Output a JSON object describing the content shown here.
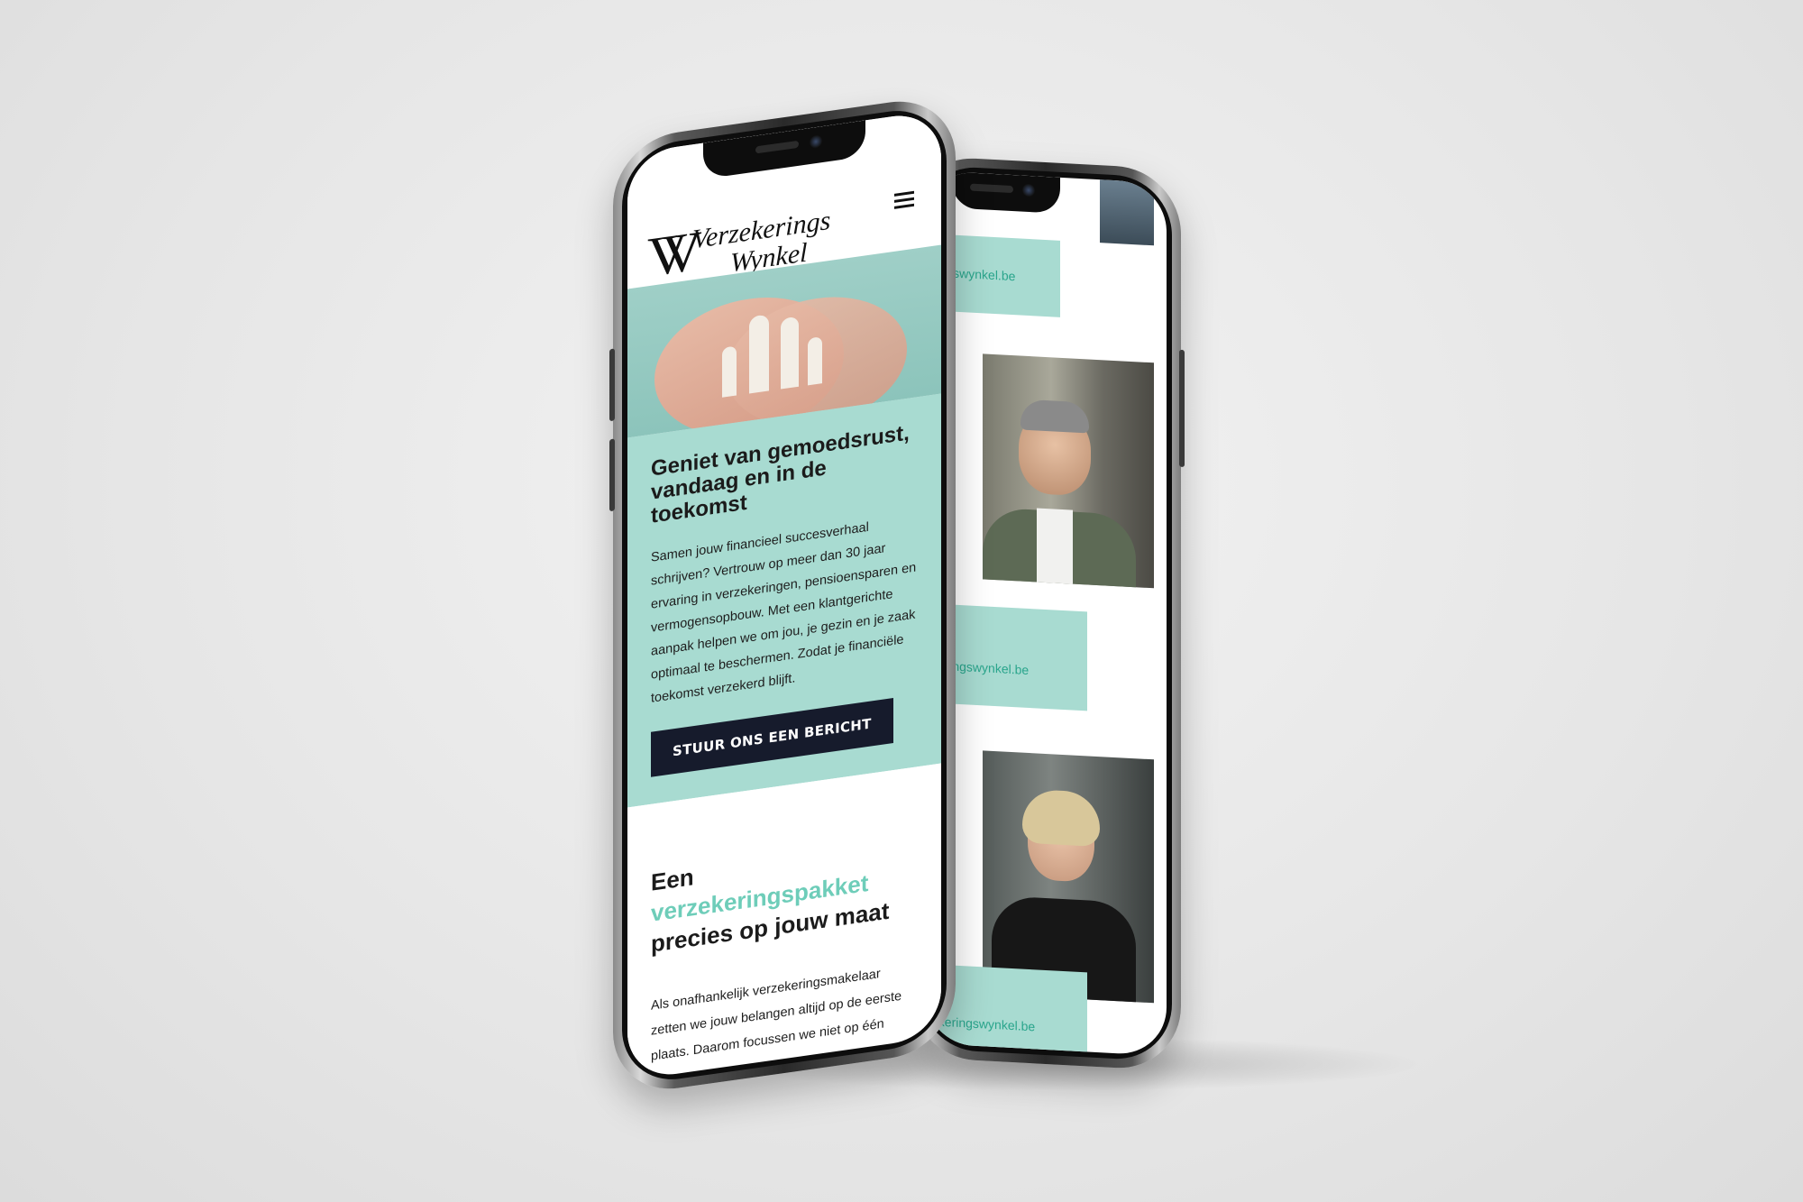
{
  "colors": {
    "mint": "#a8dbd1",
    "accent_text": "#6ecdb9",
    "email_text": "#2aa58c",
    "button_bg": "#161b2c"
  },
  "front_phone": {
    "header": {
      "logo_line1": "Verzekerings",
      "logo_line2": "Wynkel",
      "menu_icon": "hamburger-menu-icon"
    },
    "hero": {
      "heading_pre": "Geniet van ",
      "heading_bold": "gemoedsrust",
      "heading_post": ", vandaag en in de toekomst",
      "body": "Samen jouw financieel succesverhaal schrijven? Vertrouw op meer dan 30 jaar ervaring in verzekeringen, pensioensparen en vermogensopbouw. Met een klantgerichte aanpak helpen we om jou, je gezin en je zaak optimaal te beschermen. Zodat je financiële toekomst verzekerd blijft.",
      "cta_label": "STUUR ONS EEN BERICHT"
    },
    "package": {
      "heading_pre": "Een ",
      "heading_accent": "verzekeringspakket",
      "heading_post": "precies op jouw maat",
      "body": "Als onafhankelijk verzekeringsmakelaar zetten we jouw belangen altijd op de eerste plaats. Daarom focussen we niet op één"
    }
  },
  "back_phone": {
    "emails": [
      "eringswynkel.be",
      "ekeringswynkel.be",
      "zekeringswynkel.be"
    ]
  }
}
